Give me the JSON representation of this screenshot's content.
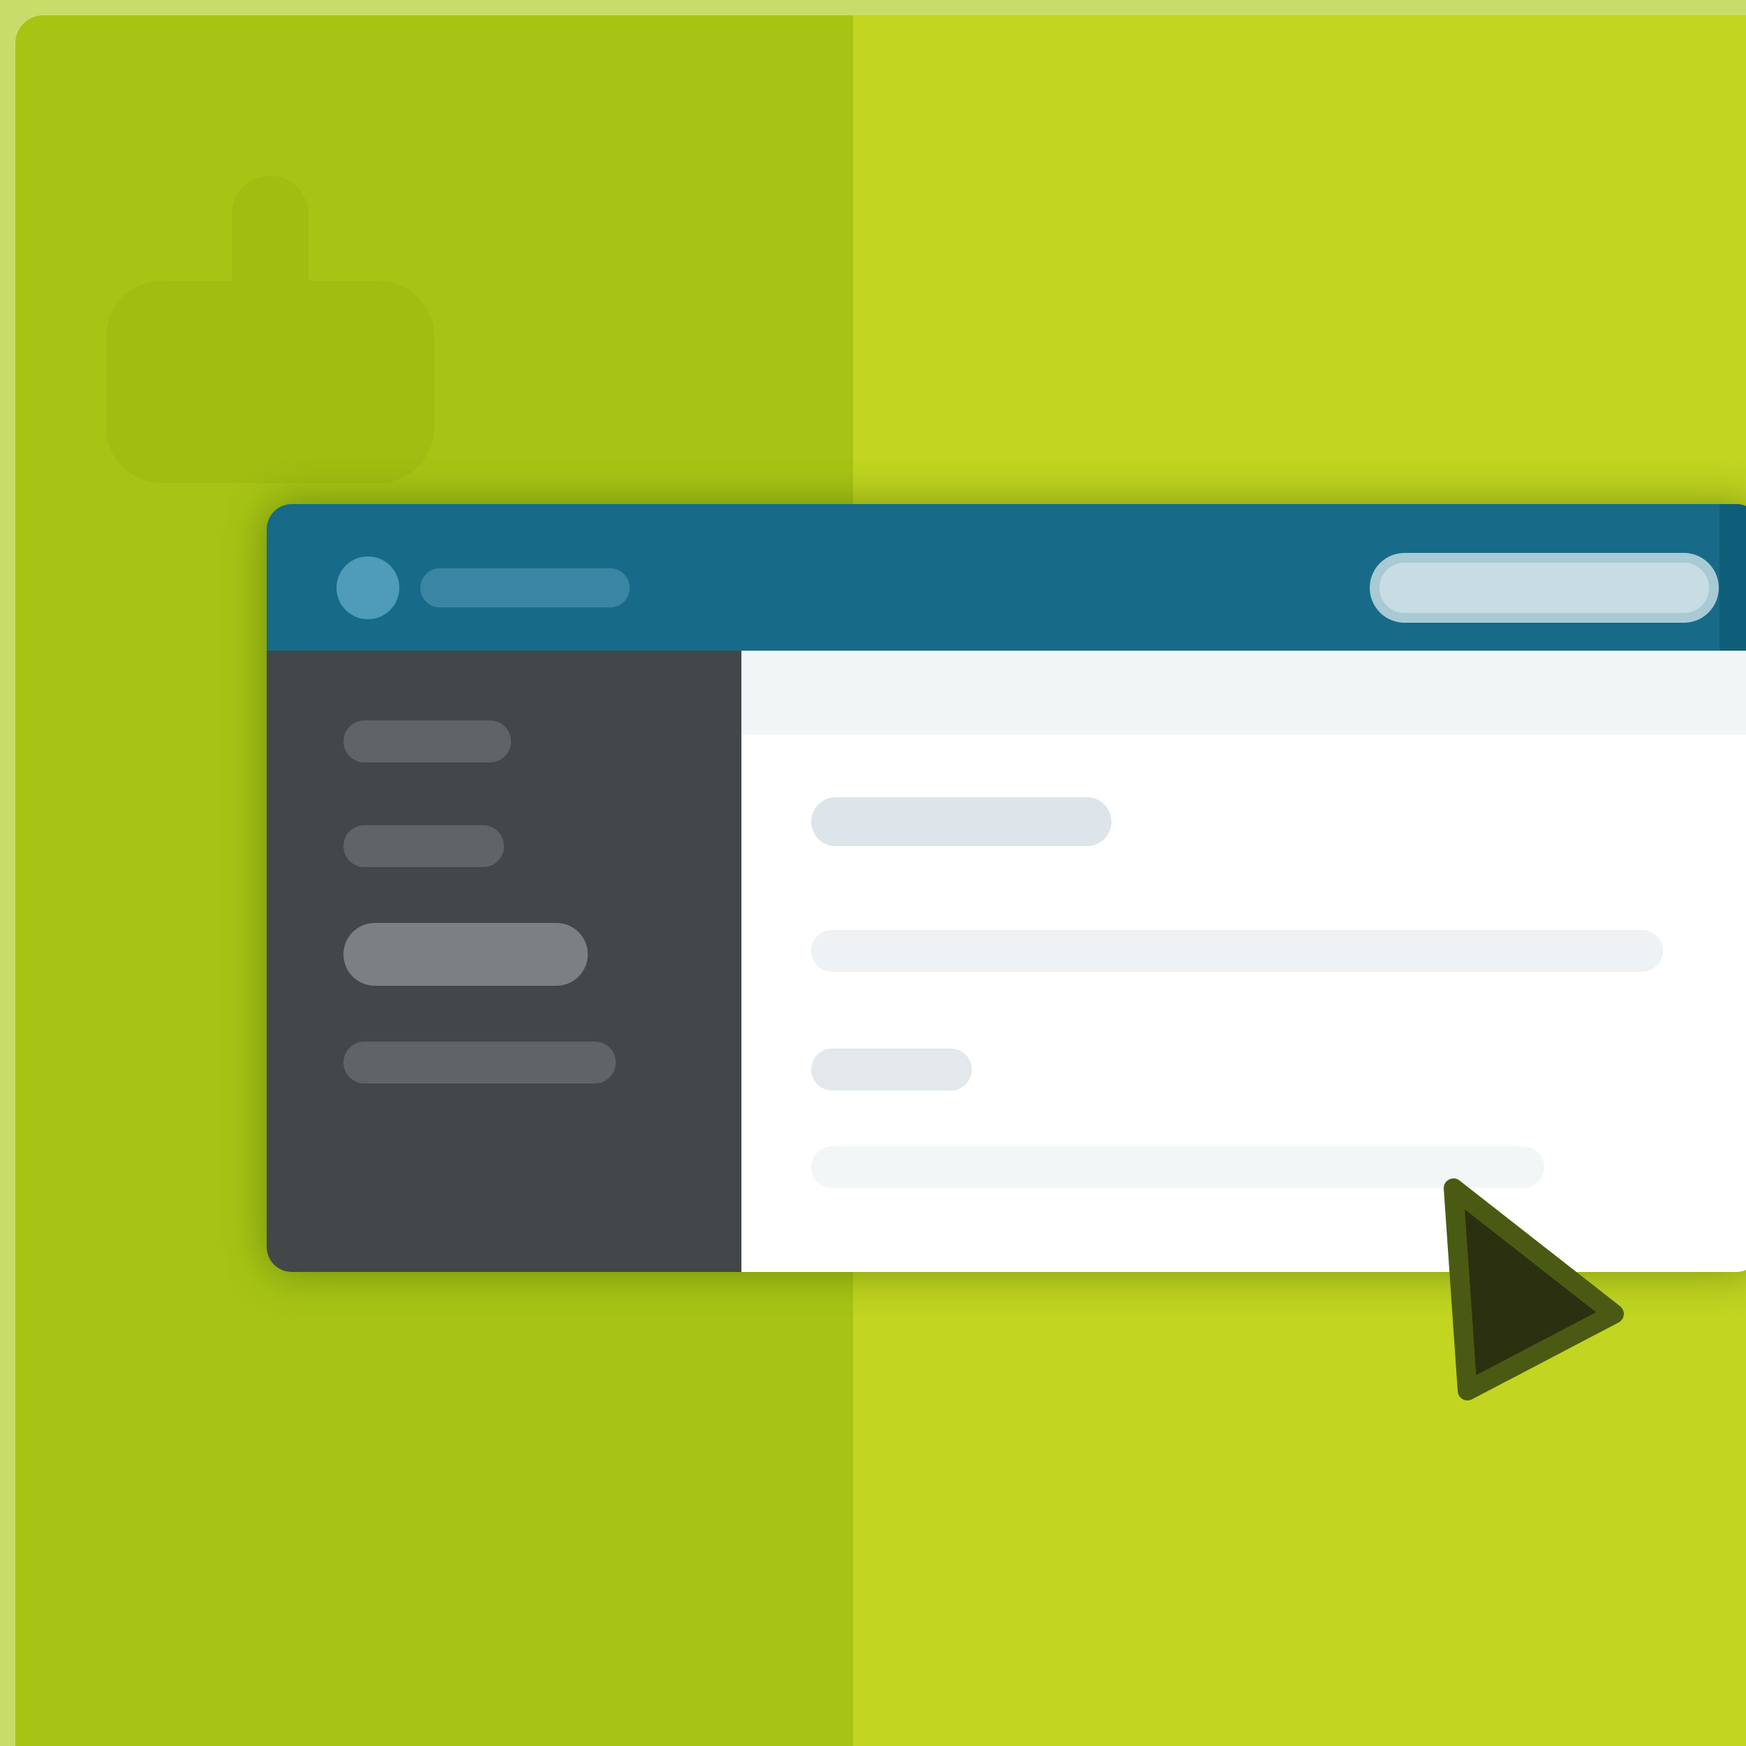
{
  "colors": {
    "frame": "#c8dc6a",
    "background_left": "#a7c415",
    "background_right": "#c1d521",
    "topbar": "#176b88",
    "sidebar": "#42474a",
    "content": "#ffffff",
    "cursor": "#2b3010"
  },
  "icons": {
    "hand": "hand-pointer-icon",
    "app_logo": "circle-logo-icon",
    "cursor": "mouse-cursor-icon"
  },
  "app": {
    "title": "",
    "search_placeholder": "",
    "sidebar_items": [
      "",
      "",
      "",
      ""
    ],
    "active_sidebar_index": 2,
    "content_heading": "",
    "content_label": ""
  }
}
